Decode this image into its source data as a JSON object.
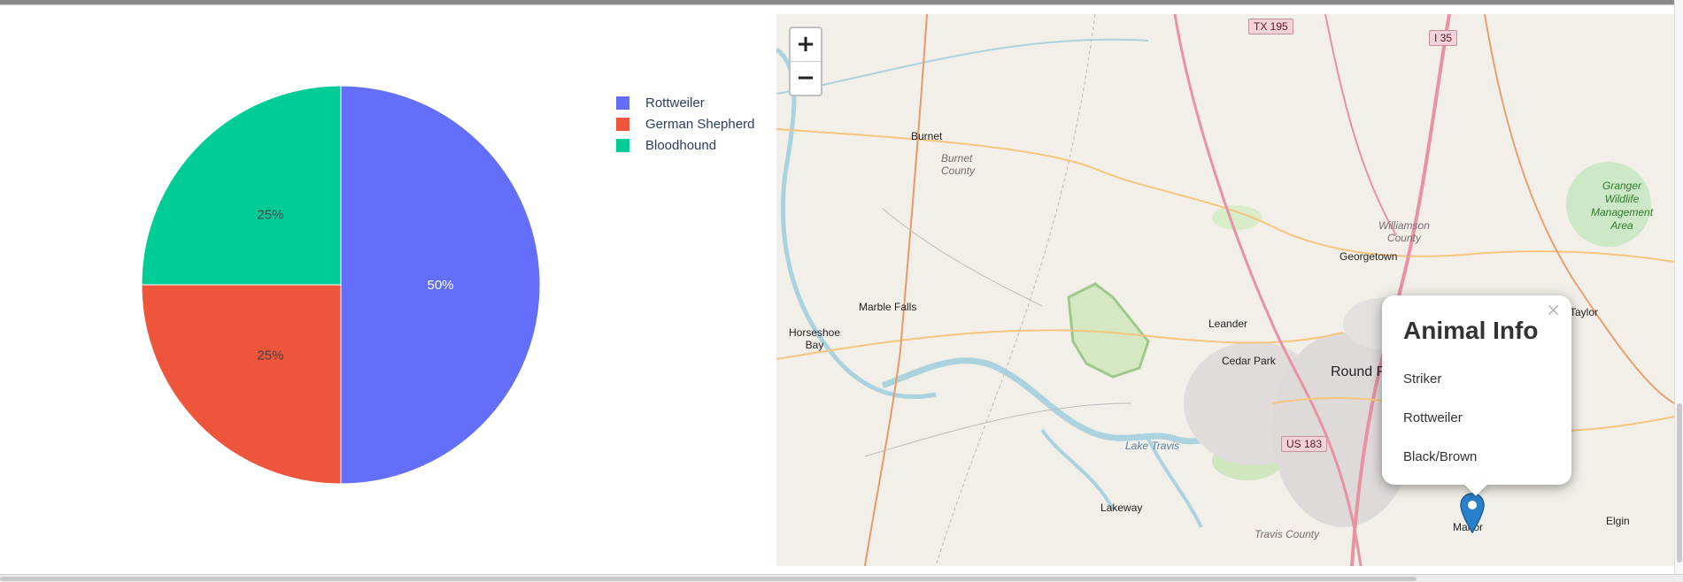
{
  "pie_chart": {
    "chart_data": {
      "type": "pie",
      "categories": [
        "Rottweiler",
        "German Shepherd",
        "Bloodhound"
      ],
      "values": [
        50,
        25,
        25
      ],
      "colors": [
        "#636efa",
        "#EF553B",
        "#00cc96"
      ],
      "labels": [
        "50%",
        "25%",
        "25%"
      ],
      "legend": "top-right",
      "title": ""
    }
  },
  "map": {
    "zoom_in_label": "+",
    "zoom_out_label": "−",
    "popup": {
      "title": "Animal Info",
      "close_label": "×",
      "name": "Striker",
      "breed": "Rottweiler",
      "color": "Black/Brown"
    },
    "places": {
      "burnet": "Burnet",
      "burnet_county": "Burnet\nCounty",
      "marble_falls": "Marble Falls",
      "horseshoe_bay": "Horseshoe\nBay",
      "leander": "Leander",
      "cedar_park": "Cedar Park",
      "round_rock": "Round R",
      "georgetown": "Georgetown",
      "williamson_county": "Williamson\nCounty",
      "taylor": "Taylor",
      "lake_travis": "Lake Travis",
      "lakeway": "Lakeway",
      "travis_county": "Travis County",
      "manor": "Manor",
      "elgin": "Elgin",
      "granger": "Granger\nWildlife\nManagement\nArea"
    },
    "shields": {
      "tx195": "TX 195",
      "i35": "I 35",
      "us183": "US 183"
    }
  }
}
